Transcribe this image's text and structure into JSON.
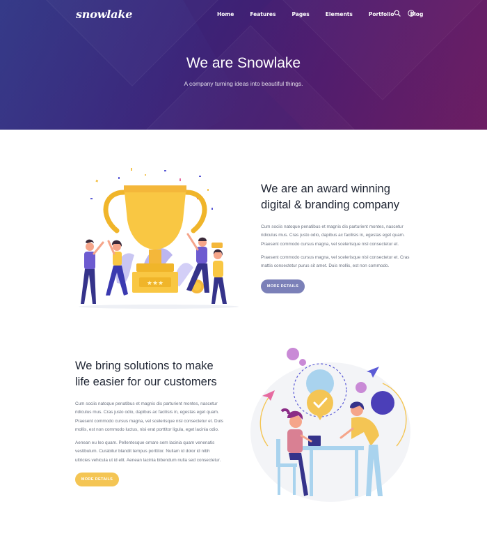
{
  "brand": {
    "logo_text": "snowlake"
  },
  "nav": {
    "items": [
      {
        "label": "Home"
      },
      {
        "label": "Features"
      },
      {
        "label": "Pages"
      },
      {
        "label": "Elements"
      },
      {
        "label": "Portfolio"
      },
      {
        "label": "Blog"
      }
    ],
    "icons": [
      "search-icon",
      "info-icon"
    ]
  },
  "hero": {
    "title": "We are Snowlake",
    "subtitle": "A company turning ideas into beautiful things."
  },
  "section_award": {
    "heading_line1": "We are an award winning",
    "heading_line2": "digital & branding company",
    "paragraph1_line1": "Cum sociis natoque penatibus et magnis dis parturient montes, nascetur",
    "paragraph1_line2": "ridiculus mus. Cras justo odio, dapibus ac facilisis in, egestas eget quam.",
    "paragraph1_line3": "Praesent commodo cursus magna, vel scelerisque nisl consectetur et.",
    "paragraph2_line1": "Praesent commodo cursus magna, vel scelerisque nisl consectetur et. Cras",
    "paragraph2_line2": "mattis consectetur purus sit amet. Duis mollis, est non commodo.",
    "button_label": "MORE DETAILS"
  },
  "section_solutions": {
    "heading_line1": "We bring solutions to make",
    "heading_line2": "life easier for our customers",
    "paragraph1_line1": "Cum sociis natoque penatibus et magnis dis parturient montes, nascetur",
    "paragraph1_line2": "ridiculus mus. Cras justo odio, dapibus ac facilisis in, egestas eget quam.",
    "paragraph1_line3": "Praesent commodo cursus magna, vel scelerisque nisl consectetur et. Duis",
    "paragraph1_line4": "mollis, est non commodo luctus, nisi erat porttitor ligula, eget lacinia odio.",
    "paragraph2_line1": "Aenean eu leo quam. Pellentesque ornare sem lacinia quam venenatis",
    "paragraph2_line2": "vestibulum. Curabitur blandit tempus porttitor. Nullam id dolor id nibh",
    "paragraph2_line3": "ultricies vehicula ut id elit. Aenean lacinia bibendum nulla sed consectetur.",
    "button_label": "MORE DETAILS"
  },
  "colors": {
    "hero_start": "#2f2f7a",
    "hero_end": "#5e1a5f",
    "button_purple": "#7b80b8",
    "button_yellow": "#f4c554",
    "heading": "#1f2533",
    "body_text": "#6b7280"
  }
}
